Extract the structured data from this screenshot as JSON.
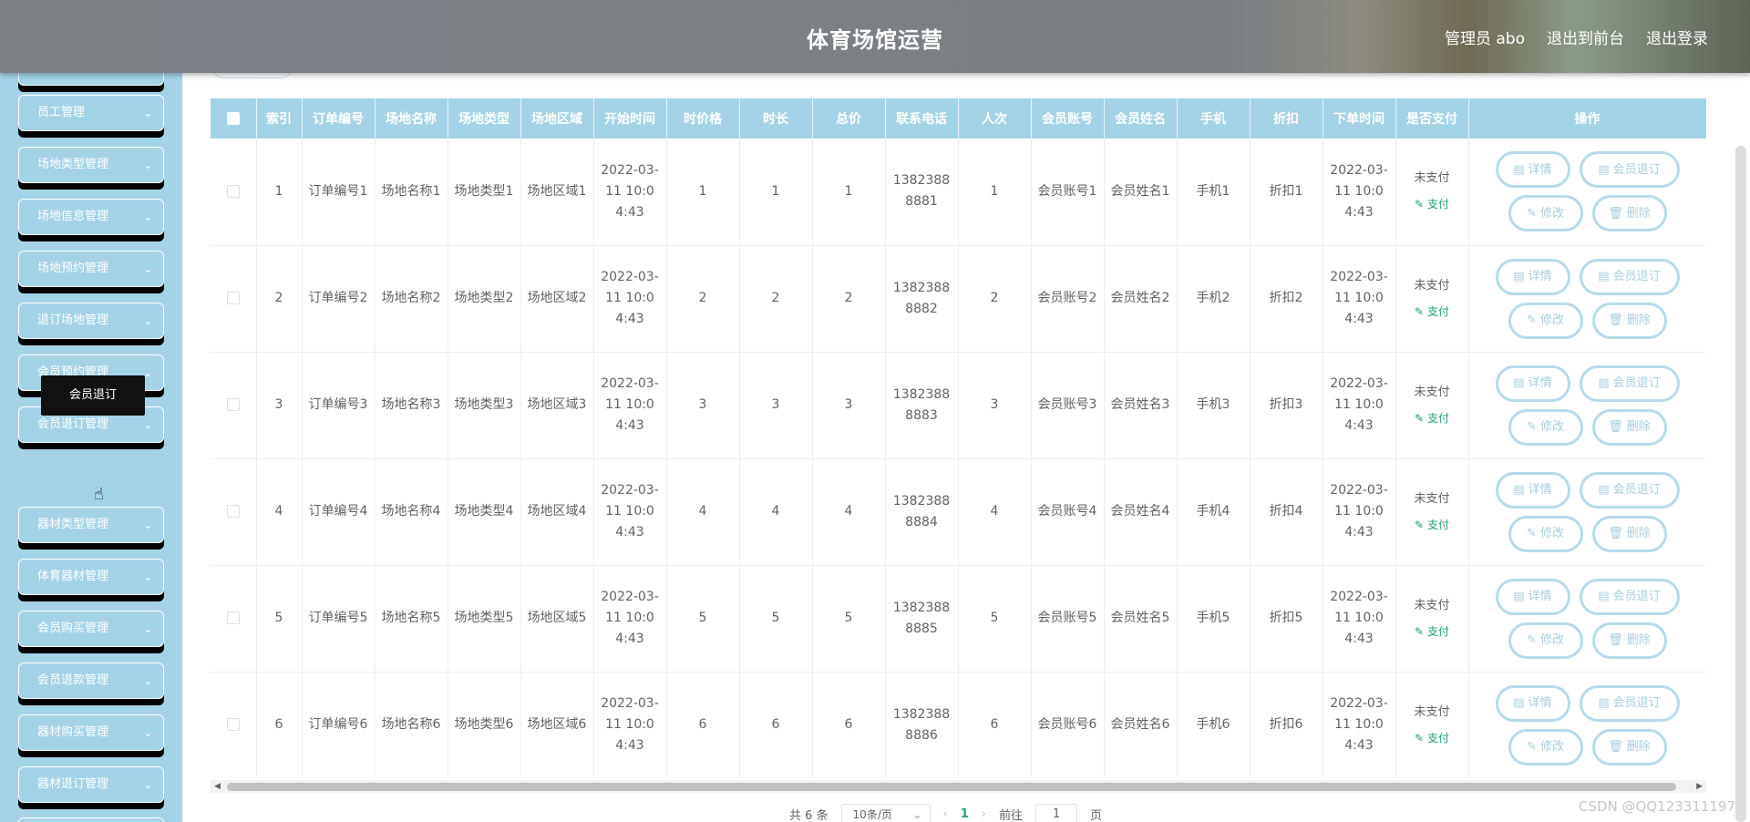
{
  "header": {
    "title": "体育场馆运营",
    "user": "管理员 abo",
    "front": "退出到前台",
    "logout": "退出登录"
  },
  "sidebar": {
    "items": [
      {
        "label": "员工管理"
      },
      {
        "label": "场地类型管理"
      },
      {
        "label": "场地信息管理"
      },
      {
        "label": "场地预约管理"
      },
      {
        "label": "退订场地管理"
      },
      {
        "label": "会员预约管理"
      },
      {
        "label": "会员退订管理"
      },
      {
        "label": "器材类型管理"
      },
      {
        "label": "体育器材管理"
      },
      {
        "label": "会员购买管理"
      },
      {
        "label": "会员退款管理"
      },
      {
        "label": "器材购买管理"
      },
      {
        "label": "器材退订管理"
      }
    ],
    "popup": "会员退订"
  },
  "table": {
    "headers": [
      "索引",
      "订单编号",
      "场地名称",
      "场地类型",
      "场地区域",
      "开始时间",
      "时价格",
      "时长",
      "总价",
      "联系电话",
      "人次",
      "会员账号",
      "会员姓名",
      "手机",
      "折扣",
      "下单时间",
      "是否支付",
      "操作"
    ],
    "rows": [
      {
        "idx": "1",
        "order": "订单编号1",
        "name": "场地名称1",
        "type": "场地类型1",
        "area": "场地区域1",
        "start": "2022-03-11 10:04:43",
        "price": "1",
        "dur": "1",
        "total": "1",
        "phone": "13823888881",
        "count": "1",
        "acct": "会员账号1",
        "mname": "会员姓名1",
        "mobile": "手机1",
        "disc": "折扣1",
        "otime": "2022-03-11 10:04:43",
        "paid": "未支付"
      },
      {
        "idx": "2",
        "order": "订单编号2",
        "name": "场地名称2",
        "type": "场地类型2",
        "area": "场地区域2",
        "start": "2022-03-11 10:04:43",
        "price": "2",
        "dur": "2",
        "total": "2",
        "phone": "13823888882",
        "count": "2",
        "acct": "会员账号2",
        "mname": "会员姓名2",
        "mobile": "手机2",
        "disc": "折扣2",
        "otime": "2022-03-11 10:04:43",
        "paid": "未支付"
      },
      {
        "idx": "3",
        "order": "订单编号3",
        "name": "场地名称3",
        "type": "场地类型3",
        "area": "场地区域3",
        "start": "2022-03-11 10:04:43",
        "price": "3",
        "dur": "3",
        "total": "3",
        "phone": "13823888883",
        "count": "3",
        "acct": "会员账号3",
        "mname": "会员姓名3",
        "mobile": "手机3",
        "disc": "折扣3",
        "otime": "2022-03-11 10:04:43",
        "paid": "未支付"
      },
      {
        "idx": "4",
        "order": "订单编号4",
        "name": "场地名称4",
        "type": "场地类型4",
        "area": "场地区域4",
        "start": "2022-03-11 10:04:43",
        "price": "4",
        "dur": "4",
        "total": "4",
        "phone": "13823888884",
        "count": "4",
        "acct": "会员账号4",
        "mname": "会员姓名4",
        "mobile": "手机4",
        "disc": "折扣4",
        "otime": "2022-03-11 10:04:43",
        "paid": "未支付"
      },
      {
        "idx": "5",
        "order": "订单编号5",
        "name": "场地名称5",
        "type": "场地类型5",
        "area": "场地区域5",
        "start": "2022-03-11 10:04:43",
        "price": "5",
        "dur": "5",
        "total": "5",
        "phone": "13823888885",
        "count": "5",
        "acct": "会员账号5",
        "mname": "会员姓名5",
        "mobile": "手机5",
        "disc": "折扣5",
        "otime": "2022-03-11 10:04:43",
        "paid": "未支付"
      },
      {
        "idx": "6",
        "order": "订单编号6",
        "name": "场地名称6",
        "type": "场地类型6",
        "area": "场地区域6",
        "start": "2022-03-11 10:04:43",
        "price": "6",
        "dur": "6",
        "total": "6",
        "phone": "13823888886",
        "count": "6",
        "acct": "会员账号6",
        "mname": "会员姓名6",
        "mobile": "手机6",
        "disc": "折扣6",
        "otime": "2022-03-11 10:04:43",
        "paid": "未支付"
      }
    ],
    "actions": {
      "pay": "支付",
      "detail": "详情",
      "cancel": "会员退订",
      "edit": "修改",
      "delete": "删除"
    }
  },
  "pagination": {
    "total": "共 6 条",
    "page_size": "10条/页",
    "current": "1",
    "goto": "前往",
    "goto_value": "1",
    "page_unit": "页"
  },
  "watermark": "CSDN @QQ123311197",
  "colors": {
    "accent": "#a5d3e6",
    "pay": "#20a070"
  }
}
